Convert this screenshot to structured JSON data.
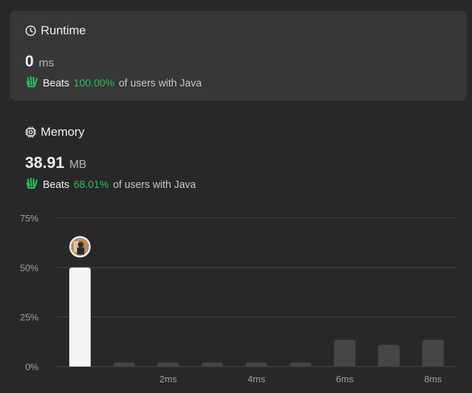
{
  "runtime": {
    "title": "Runtime",
    "icon": "clock-icon",
    "value": "0",
    "unit": "ms",
    "beats_label": "Beats",
    "beats_pct": "100.00%",
    "beats_suffix": "of users with Java"
  },
  "memory": {
    "title": "Memory",
    "icon": "chip-icon",
    "value": "38.91",
    "unit": "MB",
    "beats_label": "Beats",
    "beats_pct": "68.01%",
    "beats_suffix": "of users with Java"
  },
  "colors": {
    "accent": "#2cbb5d",
    "highlight_bar": "#f5f5f5",
    "bar": "#464646",
    "gridline": "#454545"
  },
  "chart_data": {
    "type": "bar",
    "y_ticks": [
      "75%",
      "50%",
      "25%",
      "0%"
    ],
    "ylim": [
      0,
      75
    ],
    "x_ticks": [
      "2ms",
      "4ms",
      "6ms",
      "8ms"
    ],
    "values": [
      50,
      2,
      2,
      2,
      2,
      2,
      13.5,
      11,
      13.5
    ],
    "highlighted_index": 0,
    "marker": "user-avatar-icon",
    "grid": true
  }
}
